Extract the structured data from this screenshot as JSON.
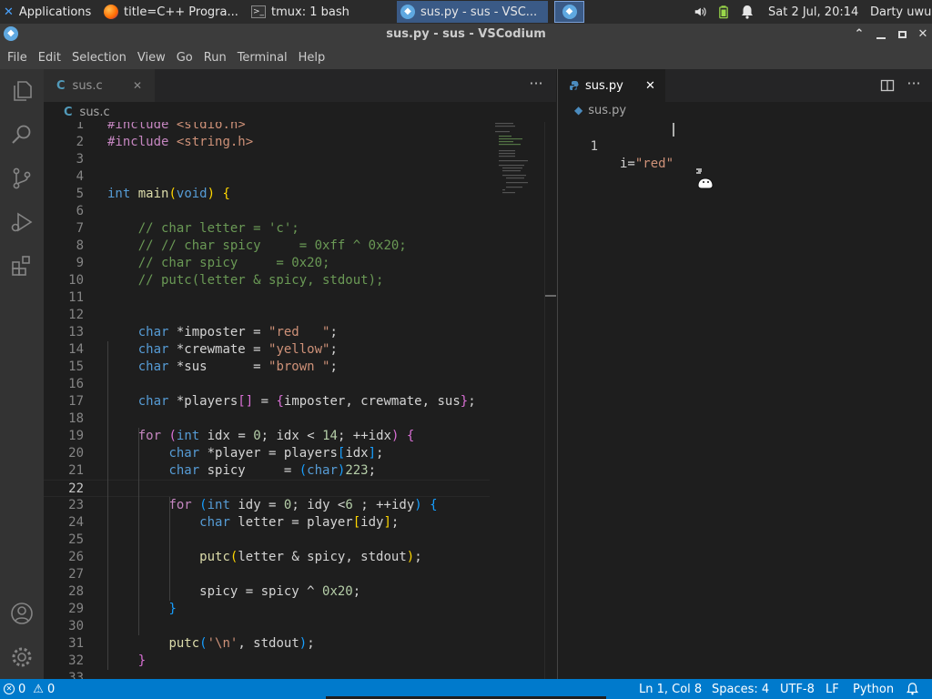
{
  "panel": {
    "apps_label": "Applications",
    "tasks": [
      {
        "label": "title=C++ Progra...",
        "icon": "firefox-icon"
      },
      {
        "label": "tmux: 1 bash",
        "icon": "terminal-icon"
      },
      {
        "label": "sus.py - sus - VSC...",
        "icon": "vscodium-icon"
      }
    ],
    "clock": "Sat  2 Jul, 20:14",
    "user": "Darty uwu"
  },
  "window": {
    "title": "sus.py - sus - VSCodium"
  },
  "menu": [
    "File",
    "Edit",
    "Selection",
    "View",
    "Go",
    "Run",
    "Terminal",
    "Help"
  ],
  "left_editor": {
    "tab_label": "sus.c",
    "tab_icon": "C",
    "breadcrumb": "sus.c",
    "lines": [
      {
        "n": "1",
        "html": "<span class=\"pp\">#include</span> <span class=\"st\">&lt;stdio.h&gt;</span>"
      },
      {
        "n": "2",
        "html": "<span class=\"pp\">#include</span> <span class=\"st\">&lt;string.h&gt;</span>"
      },
      {
        "n": "3",
        "html": ""
      },
      {
        "n": "4",
        "html": ""
      },
      {
        "n": "5",
        "html": "<span class=\"ty\">int</span> <span class=\"fn\">main</span><span class=\"br1\">(</span><span class=\"ty\">void</span><span class=\"br1\">)</span> <span class=\"br1\">{</span>"
      },
      {
        "n": "6",
        "html": ""
      },
      {
        "n": "7",
        "html": "    <span class=\"cm\">// char letter = 'c';</span>"
      },
      {
        "n": "8",
        "html": "    <span class=\"cm\">// // char spicy     = 0xff ^ 0x20;</span>"
      },
      {
        "n": "9",
        "html": "    <span class=\"cm\">// char spicy     = 0x20;</span>"
      },
      {
        "n": "10",
        "html": "    <span class=\"cm\">// putc(letter &amp; spicy, stdout);</span>"
      },
      {
        "n": "11",
        "html": ""
      },
      {
        "n": "12",
        "html": ""
      },
      {
        "n": "13",
        "html": "    <span class=\"ty\">char</span> *imposter = <span class=\"st\">\"red   \"</span>;"
      },
      {
        "n": "14",
        "html": "    <span class=\"ty\">char</span> *crewmate = <span class=\"st\">\"yellow\"</span>;"
      },
      {
        "n": "15",
        "html": "    <span class=\"ty\">char</span> *sus      = <span class=\"st\">\"brown \"</span>;"
      },
      {
        "n": "16",
        "html": ""
      },
      {
        "n": "17",
        "html": "    <span class=\"ty\">char</span> *players<span class=\"br2\">[]</span> = <span class=\"br2\">{</span>imposter, crewmate, sus<span class=\"br2\">}</span>;"
      },
      {
        "n": "18",
        "html": ""
      },
      {
        "n": "19",
        "html": "    <span class=\"pp\">for</span> <span class=\"br2\">(</span><span class=\"ty\">int</span> idx = <span class=\"nu\">0</span>; idx &lt; <span class=\"nu\">14</span>; ++idx<span class=\"br2\">)</span> <span class=\"br2\">{</span>"
      },
      {
        "n": "20",
        "html": "        <span class=\"ty\">char</span> *player = players<span class=\"br3\">[</span>idx<span class=\"br3\">]</span>;"
      },
      {
        "n": "21",
        "html": "        <span class=\"ty\">char</span> spicy     = <span class=\"br3\">(</span><span class=\"ty\">char</span><span class=\"br3\">)</span><span class=\"nu\">223</span>;"
      },
      {
        "n": "22",
        "html": ""
      },
      {
        "n": "23",
        "html": "        <span class=\"pp\">for</span> <span class=\"br3\">(</span><span class=\"ty\">int</span> idy = <span class=\"nu\">0</span>; idy &lt;<span class=\"nu\">6</span> ; ++idy<span class=\"br3\">)</span> <span class=\"br3\">{</span>"
      },
      {
        "n": "24",
        "html": "            <span class=\"ty\">char</span> letter = player<span class=\"br1\">[</span>idy<span class=\"br1\">]</span>;"
      },
      {
        "n": "25",
        "html": ""
      },
      {
        "n": "26",
        "html": "            <span class=\"fn\">putc</span><span class=\"br1\">(</span>letter &amp; spicy, stdout<span class=\"br1\">)</span>;"
      },
      {
        "n": "27",
        "html": ""
      },
      {
        "n": "28",
        "html": "            spicy = spicy ^ <span class=\"nu\">0x20</span>;"
      },
      {
        "n": "29",
        "html": "        <span class=\"br3\">}</span>"
      },
      {
        "n": "30",
        "html": ""
      },
      {
        "n": "31",
        "html": "        <span class=\"fn\">putc</span><span class=\"br3\">(</span><span class=\"st\">'\\n'</span>, stdout<span class=\"br3\">)</span>;"
      },
      {
        "n": "32",
        "html": "    <span class=\"br2\">}</span>"
      },
      {
        "n": "33",
        "html": ""
      }
    ]
  },
  "right_editor": {
    "tab_label": "sus.py",
    "breadcrumb": "sus.py",
    "line_number": "1",
    "code_prefix": "i=",
    "code_string": "\"red\""
  },
  "status": {
    "errors": "0",
    "warnings": "0",
    "position": "Ln 1, Col 8",
    "spaces": "Spaces: 4",
    "encoding": "UTF-8",
    "eol": "LF",
    "language": "Python"
  },
  "colors": {
    "accent": "#007acc",
    "panel_active": "#3a5a86",
    "editor_bg": "#1e1e1e"
  }
}
